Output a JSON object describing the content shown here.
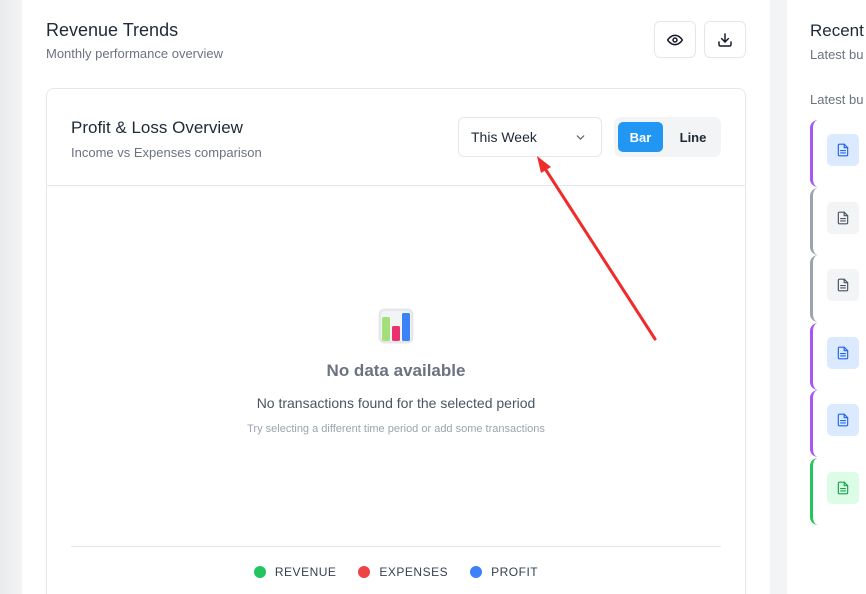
{
  "header": {
    "title": "Revenue Trends",
    "subtitle": "Monthly performance overview",
    "view_icon": "eye-icon",
    "download_icon": "download-icon"
  },
  "panel": {
    "title": "Profit & Loss Overview",
    "subtitle": "Income vs Expenses comparison",
    "period": {
      "selected": "This Week"
    },
    "chart_toggle": {
      "bar_label": "Bar",
      "line_label": "Line",
      "active": "Bar"
    },
    "empty_state": {
      "icon": "bar-chart-icon",
      "title": "No data available",
      "message": "No transactions found for the selected period",
      "hint": "Try selecting a different time period or add some transactions"
    },
    "legend": [
      {
        "label": "REVENUE",
        "color": "#22c55e"
      },
      {
        "label": "EXPENSES",
        "color": "#ef4444"
      },
      {
        "label": "PROFIT",
        "color": "#3b82f6"
      }
    ]
  },
  "side_panel": {
    "title": "Recent",
    "subtitle": "Latest bu",
    "section_label": "Latest bu",
    "documents": [
      {
        "accent": "#a855f7",
        "bg": "#dbeafe",
        "icon_color": "#2563eb",
        "icon": "document-icon"
      },
      {
        "accent": "#9ca3af",
        "bg": "#f3f4f6",
        "icon_color": "#4b5563",
        "icon": "document-icon"
      },
      {
        "accent": "#9ca3af",
        "bg": "#f3f4f6",
        "icon_color": "#4b5563",
        "icon": "document-icon"
      },
      {
        "accent": "#a855f7",
        "bg": "#dbeafe",
        "icon_color": "#2563eb",
        "icon": "document-icon"
      },
      {
        "accent": "#a855f7",
        "bg": "#dbeafe",
        "icon_color": "#2563eb",
        "icon": "document-icon"
      },
      {
        "accent": "#22c55e",
        "bg": "#dcfce7",
        "icon_color": "#16a34a",
        "icon": "document-icon"
      }
    ]
  },
  "colors": {
    "accent": "#2196f3",
    "annotation_arrow": "#ef2b2b"
  }
}
